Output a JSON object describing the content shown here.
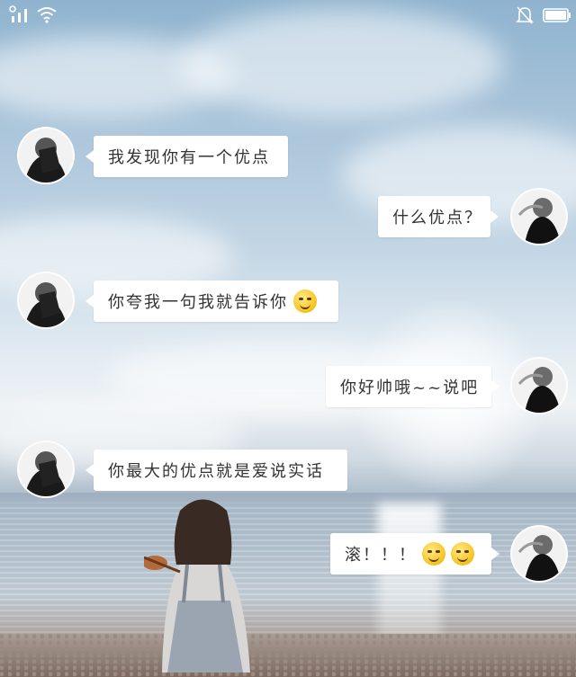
{
  "messages": [
    {
      "side": "left",
      "text": "我发现你有一个优点",
      "emojis": []
    },
    {
      "side": "right",
      "text": "什么优点？",
      "emojis": []
    },
    {
      "side": "left",
      "text": "你夸我一句我就告诉你",
      "emojis": [
        "smirk-emoji"
      ]
    },
    {
      "side": "right",
      "text": "你好帅哦~~说吧",
      "emojis": []
    },
    {
      "side": "left",
      "text": "你最大的优点就是爱说实话",
      "emojis": []
    },
    {
      "side": "right",
      "text": "滚！！！",
      "emojis": [
        "smile-emoji",
        "smile-emoji"
      ]
    }
  ],
  "status_bar": {
    "icons": [
      "signal-icon",
      "wifi-icon",
      "mute-bell-icon",
      "battery-icon"
    ]
  },
  "colors": {
    "bubble": "#ffffff",
    "text": "#333333",
    "sky": "#a9c4da"
  }
}
